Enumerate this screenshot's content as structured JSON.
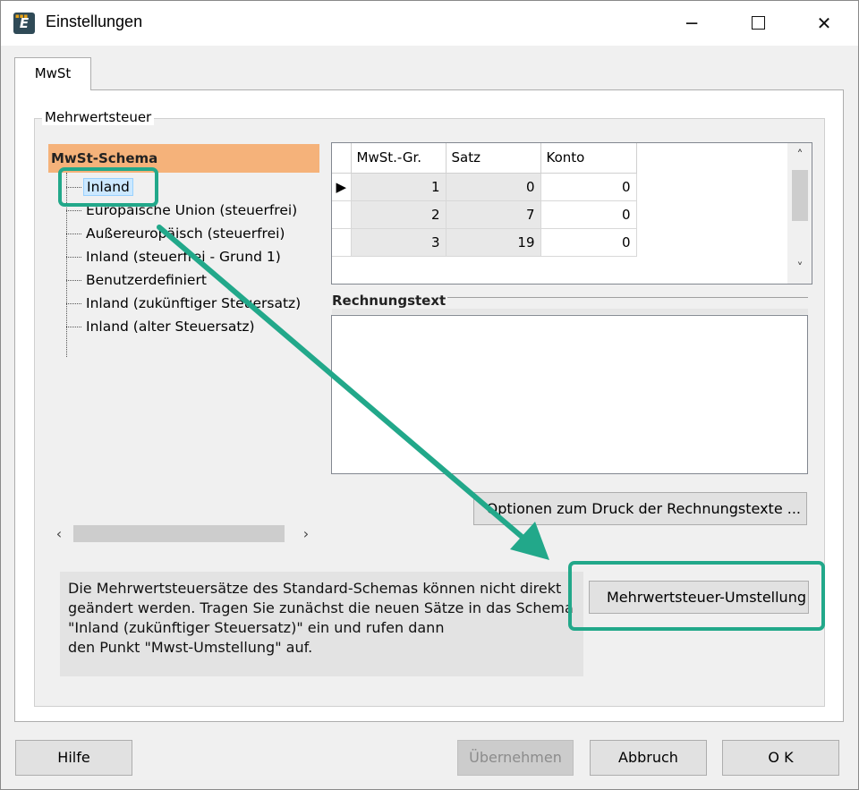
{
  "window": {
    "title": "Einstellungen",
    "app_icon_letter": "E",
    "minimize_icon": "minimize-icon",
    "maximize_icon": "maximize-icon",
    "close_icon": "close-icon"
  },
  "tabs": [
    {
      "label": "MwSt",
      "active": true
    }
  ],
  "group": {
    "legend": "Mehrwertsteuer",
    "tree": {
      "root": "MwSt-Schema",
      "items": [
        {
          "label": "Inland",
          "selected": true
        },
        {
          "label": "Europäische Union (steuerfrei)"
        },
        {
          "label": "Außereuropäisch (steuerfrei)"
        },
        {
          "label": "Inland (steuerfrei - Grund 1)"
        },
        {
          "label": "Benutzerdefiniert"
        },
        {
          "label": "Inland (zukünftiger Steuersatz)"
        },
        {
          "label": "Inland (alter Steuersatz)"
        }
      ]
    },
    "grid": {
      "columns": [
        "MwSt.-Gr.",
        "Satz",
        "Konto"
      ],
      "rows": [
        {
          "gruppe": "1",
          "satz": "0",
          "konto": "0"
        },
        {
          "gruppe": "2",
          "satz": "7",
          "konto": "0"
        },
        {
          "gruppe": "3",
          "satz": "19",
          "konto": "0"
        }
      ]
    },
    "rechnungstext": {
      "label": "Rechnungstext",
      "value": ""
    },
    "options_button": "Optionen zum Druck der Rechnungstexte ...",
    "info_text": "Die Mehrwertsteuersätze des Standard-Schemas können nicht direkt geändert werden. Tragen Sie zunächst die neuen Sätze in das Schema \"Inland (zukünftiger Steuersatz)\" ein und rufen dann\nden Punkt \"Mwst-Umstellung\" auf.",
    "umstellung_button": "Mehrwertsteuer-Umstellung"
  },
  "footer": {
    "help": "Hilfe",
    "apply": "Übernehmen",
    "cancel": "Abbruch",
    "ok": "O K"
  },
  "colors": {
    "annotation": "#22a88a",
    "tree_root_bg": "#f5b27a",
    "selection_bg": "#cce8ff"
  }
}
